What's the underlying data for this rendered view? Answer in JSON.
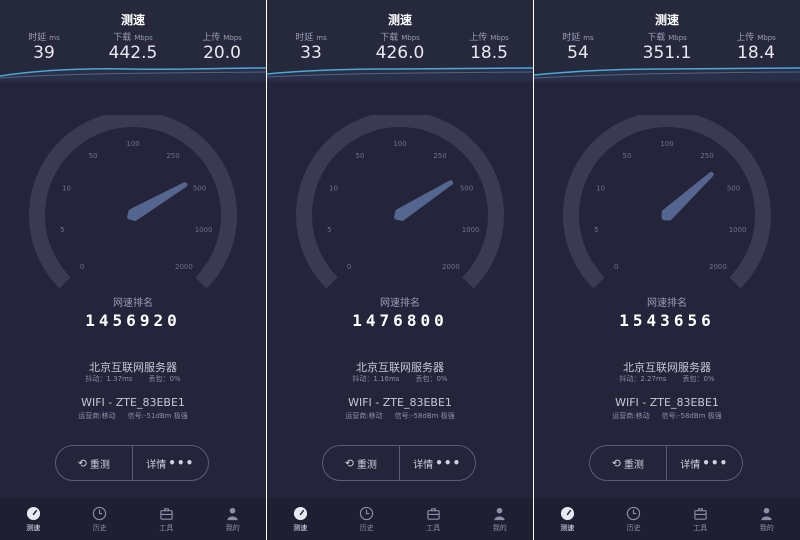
{
  "colors": {
    "background": "#24243a",
    "accent_line": "#4aa9d6",
    "gauge_track": "#3a3b53",
    "needle": "#5a6d9a"
  },
  "panels": [
    {
      "title": "测速",
      "latency": {
        "label": "时延",
        "unit": "ms",
        "value": "39"
      },
      "download": {
        "label": "下载",
        "unit": "Mbps",
        "value": "442.5"
      },
      "upload": {
        "label": "上传",
        "unit": "Mbps",
        "value": "20.0"
      },
      "gauge_ticks": [
        "0",
        "5",
        "10",
        "50",
        "100",
        "250",
        "500",
        "1000",
        "2000"
      ],
      "gauge_speed_mbps": 442.5,
      "rank_label": "网速排名",
      "rank_value": "1456920",
      "server_name": "北京互联网服务器",
      "jitter": "抖动：1.37ms",
      "packet_loss": "丢包：0%",
      "wifi_name": "WIFI - ZTE_83EBE1",
      "carrier": "运营商:移动",
      "signal": "信号:-51dBm 极强",
      "retest_label": "重测",
      "details_label": "详情",
      "tabs": [
        {
          "label": "测速",
          "icon": "speedometer-icon"
        },
        {
          "label": "历史",
          "icon": "clock-icon"
        },
        {
          "label": "工具",
          "icon": "toolbox-icon"
        },
        {
          "label": "我的",
          "icon": "user-icon"
        }
      ]
    },
    {
      "title": "测速",
      "latency": {
        "label": "时延",
        "unit": "ms",
        "value": "33"
      },
      "download": {
        "label": "下载",
        "unit": "Mbps",
        "value": "426.0"
      },
      "upload": {
        "label": "上传",
        "unit": "Mbps",
        "value": "18.5"
      },
      "gauge_ticks": [
        "0",
        "5",
        "10",
        "50",
        "100",
        "250",
        "500",
        "1000",
        "2000"
      ],
      "gauge_speed_mbps": 426.0,
      "rank_label": "网速排名",
      "rank_value": "1476800",
      "server_name": "北京互联网服务器",
      "jitter": "抖动：1.16ms",
      "packet_loss": "丢包：0%",
      "wifi_name": "WIFI - ZTE_83EBE1",
      "carrier": "运营商:移动",
      "signal": "信号:-58dBm 极强",
      "retest_label": "重测",
      "details_label": "详情",
      "tabs": [
        {
          "label": "测速",
          "icon": "speedometer-icon"
        },
        {
          "label": "历史",
          "icon": "clock-icon"
        },
        {
          "label": "工具",
          "icon": "toolbox-icon"
        },
        {
          "label": "我的",
          "icon": "user-icon"
        }
      ]
    },
    {
      "title": "测速",
      "latency": {
        "label": "时延",
        "unit": "ms",
        "value": "54"
      },
      "download": {
        "label": "下载",
        "unit": "Mbps",
        "value": "351.1"
      },
      "upload": {
        "label": "上传",
        "unit": "Mbps",
        "value": "18.4"
      },
      "gauge_ticks": [
        "0",
        "5",
        "10",
        "50",
        "100",
        "250",
        "500",
        "1000",
        "2000"
      ],
      "gauge_speed_mbps": 351.1,
      "rank_label": "网速排名",
      "rank_value": "1543656",
      "server_name": "北京互联网服务器",
      "jitter": "抖动：2.27ms",
      "packet_loss": "丢包：0%",
      "wifi_name": "WIFI - ZTE_83EBE1",
      "carrier": "运营商:移动",
      "signal": "信号:-58dBm 极强",
      "retest_label": "重测",
      "details_label": "详情",
      "tabs": [
        {
          "label": "测速",
          "icon": "speedometer-icon"
        },
        {
          "label": "历史",
          "icon": "clock-icon"
        },
        {
          "label": "工具",
          "icon": "toolbox-icon"
        },
        {
          "label": "我的",
          "icon": "user-icon"
        }
      ]
    }
  ]
}
